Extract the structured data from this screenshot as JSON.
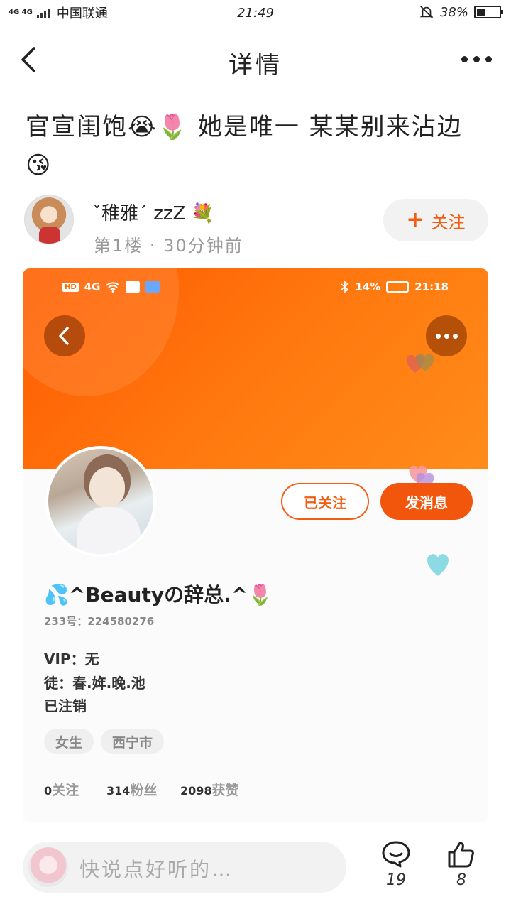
{
  "status_bar": {
    "network": "4G 4G",
    "carrier": "中国联通",
    "time": "21:49",
    "battery": "38%",
    "icons": [
      "signal-icon",
      "mute-bell-icon",
      "battery-icon"
    ]
  },
  "nav": {
    "title": "详情",
    "icons": [
      "back-arrow-icon",
      "more-dots-icon"
    ]
  },
  "post": {
    "title": "官宣闺饱😭🌷 她是唯一 某某别来沾边😘"
  },
  "author": {
    "name": "ˇ稚雅ˊ zzZ 💐",
    "meta": "第1楼 · 30分钟前",
    "follow_label": "关注"
  },
  "screenshot": {
    "inner_status": {
      "left": "4G",
      "right_percent": "14%",
      "time": "21:18"
    },
    "following_label": "已关注",
    "message_label": "发消息",
    "profile_name": "💦^Beautyの辞总.^🌷",
    "id_label": "233号：224580276",
    "vip": "VIP：无",
    "disciple": "徒：春.姩.晚.池",
    "status": "已注销",
    "tags": [
      "女生",
      "西宁市"
    ],
    "stats": [
      {
        "num": "0",
        "label": "关注"
      },
      {
        "num": "314",
        "label": "粉丝"
      },
      {
        "num": "2098",
        "label": "获赞"
      }
    ],
    "colors": {
      "banner": "#ff6a00",
      "accent": "#f2560d"
    }
  },
  "bottom": {
    "placeholder": "快说点好听的…",
    "comment_count": "19",
    "like_count": "8"
  }
}
